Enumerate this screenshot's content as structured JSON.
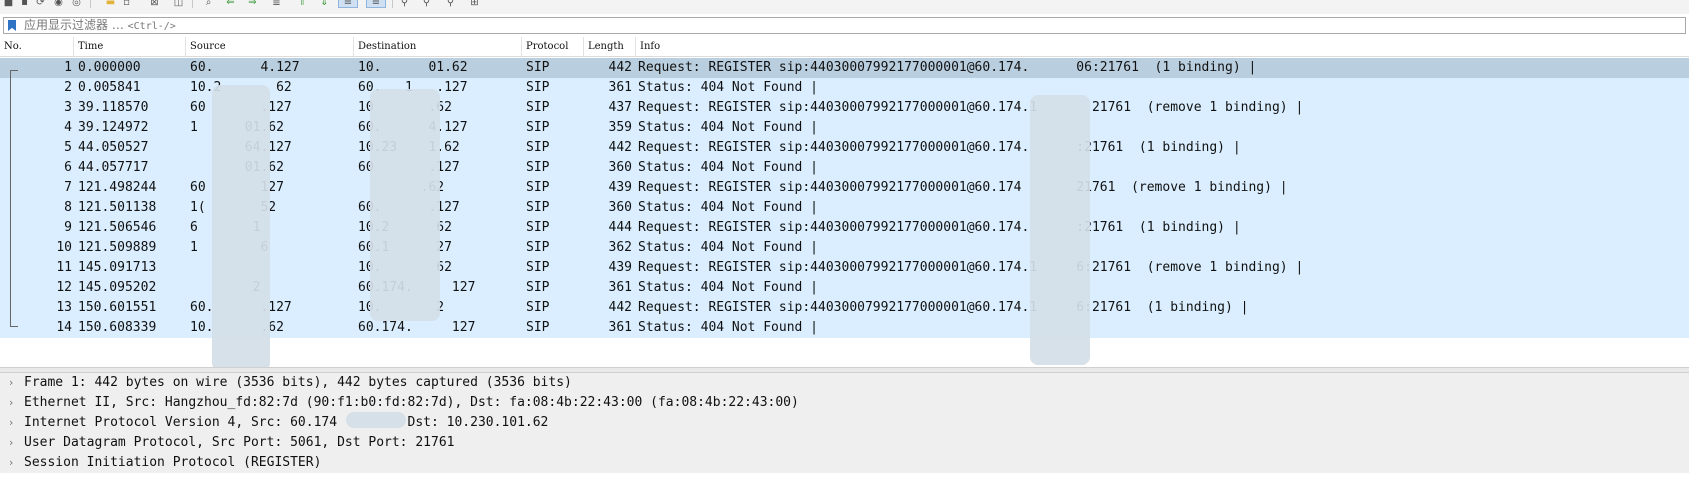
{
  "filter": {
    "placeholder": "应用显示过滤器 … ",
    "shortcut": "<Ctrl-/>"
  },
  "columns": [
    "No.",
    "Time",
    "Source",
    "Destination",
    "Protocol",
    "Length",
    "Info"
  ],
  "packets": [
    {
      "no": "1",
      "time": "0.000000",
      "src": "60.      4.127",
      "dst": "10.      01.62",
      "proto": "SIP",
      "len": "442",
      "info": "Request: REGISTER sip:44030007992177000001@60.174.      06:21761  (1 binding) |"
    },
    {
      "no": "2",
      "time": "0.005841",
      "src": "10.2       62",
      "dst": "60.   1   .127",
      "proto": "SIP",
      "len": "361",
      "info": "Status: 404 Not Found |"
    },
    {
      "no": "3",
      "time": "39.118570",
      "src": "60       .127",
      "dst": "10       .62",
      "proto": "SIP",
      "len": "437",
      "info": "Request: REGISTER sip:44030007992177000001@60.174.1       21761  (remove 1 binding) |"
    },
    {
      "no": "4",
      "time": "39.124972",
      "src": "1      01.62",
      "dst": "60.      4.127",
      "proto": "SIP",
      "len": "359",
      "info": "Status: 404 Not Found |"
    },
    {
      "no": "5",
      "time": "44.050527",
      "src": "       64.127",
      "dst": "10.23    1.62",
      "proto": "SIP",
      "len": "442",
      "info": "Request: REGISTER sip:44030007992177000001@60.174.      :21761  (1 binding) |"
    },
    {
      "no": "6",
      "time": "44.057717",
      "src": "       01.62",
      "dst": "60       .127",
      "proto": "SIP",
      "len": "360",
      "info": "Status: 404 Not Found |"
    },
    {
      "no": "7",
      "time": "121.498244",
      "src": "60       127",
      "dst": "        .62",
      "proto": "SIP",
      "len": "439",
      "info": "Request: REGISTER sip:44030007992177000001@60.174       21761  (remove 1 binding) |"
    },
    {
      "no": "8",
      "time": "121.501138",
      "src": "1(       52",
      "dst": "60.      .127",
      "proto": "SIP",
      "len": "360",
      "info": "Status: 404 Not Found |"
    },
    {
      "no": "9",
      "time": "121.506546",
      "src": "6       1",
      "dst": "10.2      62",
      "proto": "SIP",
      "len": "444",
      "info": "Request: REGISTER sip:44030007992177000001@60.174.      :21761  (1 binding) |"
    },
    {
      "no": "10",
      "time": "121.509889",
      "src": "1        6",
      "dst": "60.1      27",
      "proto": "SIP",
      "len": "362",
      "info": "Status: 404 Not Found |"
    },
    {
      "no": "11",
      "time": "145.091713",
      "src": "",
      "dst": "10.       62",
      "proto": "SIP",
      "len": "439",
      "info": "Request: REGISTER sip:44030007992177000001@60.174.1     6:21761  (remove 1 binding) |"
    },
    {
      "no": "12",
      "time": "145.095202",
      "src": "        2",
      "dst": "60.174.     127",
      "proto": "SIP",
      "len": "361",
      "info": "Status: 404 Not Found |"
    },
    {
      "no": "13",
      "time": "150.601551",
      "src": "60.      .127",
      "dst": "10.       2",
      "proto": "SIP",
      "len": "442",
      "info": "Request: REGISTER sip:44030007992177000001@60.174.1     6:21761  (1 binding) |"
    },
    {
      "no": "14",
      "time": "150.608339",
      "src": "10.      .62",
      "dst": "60.174.     127",
      "proto": "SIP",
      "len": "361",
      "info": "Status: 404 Not Found |"
    }
  ],
  "details": [
    "Frame 1: 442 bytes on wire (3536 bits), 442 bytes captured (3536 bits)",
    "Ethernet II, Src: Hangzhou_fd:82:7d (90:f1:b0:fd:82:7d), Dst: fa:08:4b:22:43:00 (fa:08:4b:22:43:00)",
    "Internet Protocol Version 4, Src: 60.174         Dst: 10.230.101.62",
    "User Datagram Protocol, Src Port: 5061, Dst Port: 21761",
    "Session Initiation Protocol (REGISTER)"
  ],
  "icons": {
    "toolbar": [
      "stop-capture-icon",
      "restart-capture-icon",
      "capture-options-icon",
      "open-file-icon",
      "save-file-icon",
      "close-file-icon",
      "reload-icon",
      "find-packet-icon",
      "go-back-icon",
      "go-forward-icon",
      "go-to-packet-icon",
      "go-first-icon",
      "go-last-icon",
      "autoscroll-icon",
      "colorize-icon",
      "zoom-in-icon",
      "zoom-out-icon",
      "zoom-normal-icon",
      "resize-columns-icon"
    ],
    "filter": "bookmark-icon",
    "tree": "expand-arrow-icon"
  },
  "colors": {
    "row_background": "#daeeff",
    "selected_row": "#b9cedf",
    "details_background": "#efefef"
  }
}
